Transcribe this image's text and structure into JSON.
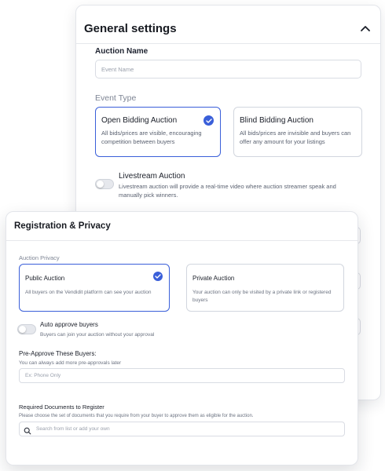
{
  "general": {
    "title": "General settings",
    "auction_name_label": "Auction Name",
    "auction_name_placeholder": "Event Name",
    "event_type_label": "Event Type",
    "options": [
      {
        "title": "Open Bidding Auction",
        "desc": "All bids/prices are visible, encouraging competition between buyers",
        "selected": true
      },
      {
        "title": "Blind Bidding Auction",
        "desc": "All bids/prices are invisible and buyers can offer any amount for your listings",
        "selected": false
      }
    ],
    "livestream": {
      "title": "Livestream Auction",
      "desc": "Livestream auction will provide a real-time video where auction streamer speak and manually pick winners.",
      "enabled": false
    },
    "icons": {
      "collapse": "chevron-up-icon",
      "selected": "check-circle-icon"
    }
  },
  "registration": {
    "title": "Registration & Privacy",
    "privacy_label": "Auction Privacy",
    "options": [
      {
        "title": "Public Auction",
        "desc": "All buyers on the Vendidit platform can see your auction",
        "selected": true
      },
      {
        "title": "Private Auction",
        "desc": "Your auction can only be visited by a private link or registered buyers",
        "selected": false
      }
    ],
    "auto_approve": {
      "title": "Auto approve buyers",
      "desc": "Buyers can join your auction without your approval",
      "enabled": false
    },
    "preapprove": {
      "title": "Pre-Approve These Buyers:",
      "desc": "You can always add more pre-approvals later",
      "placeholder": "Ex: Phone Only"
    },
    "documents": {
      "title": "Required Documents to Register",
      "desc": "Please choose the set of documents that you require from your buyer to approve them as eligible for the auction.",
      "placeholder": "Search from list or add your own"
    },
    "icons": {
      "search": "search-icon",
      "selected": "check-circle-icon"
    }
  },
  "colors": {
    "accent": "#3a5fd9",
    "border": "#d2d6de",
    "muted": "#7e8594"
  }
}
